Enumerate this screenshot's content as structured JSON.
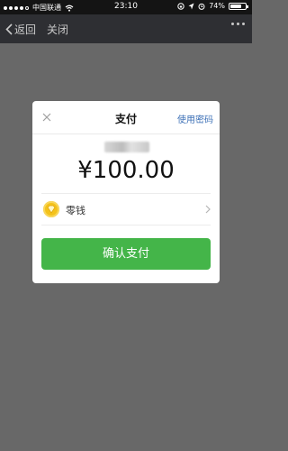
{
  "status_bar": {
    "carrier": "中国联通",
    "time": "23:10",
    "battery": "74%",
    "battery_level": 0.74
  },
  "nav": {
    "back_label": "返回",
    "close_label": "关闭"
  },
  "payment": {
    "title": "支付",
    "use_password_label": "使用密码",
    "amount": "¥100.00",
    "method_label": "零钱",
    "confirm_label": "确认支付"
  },
  "icons": {
    "back": "chevron-left-icon",
    "more": "more-icon",
    "close": "close-icon",
    "wallet": "coin-icon",
    "chevron": "chevron-right-icon"
  },
  "colors": {
    "confirm_green": "#44b549",
    "link_blue": "#3b6fb6",
    "coin_yellow": "#f4c21a"
  }
}
